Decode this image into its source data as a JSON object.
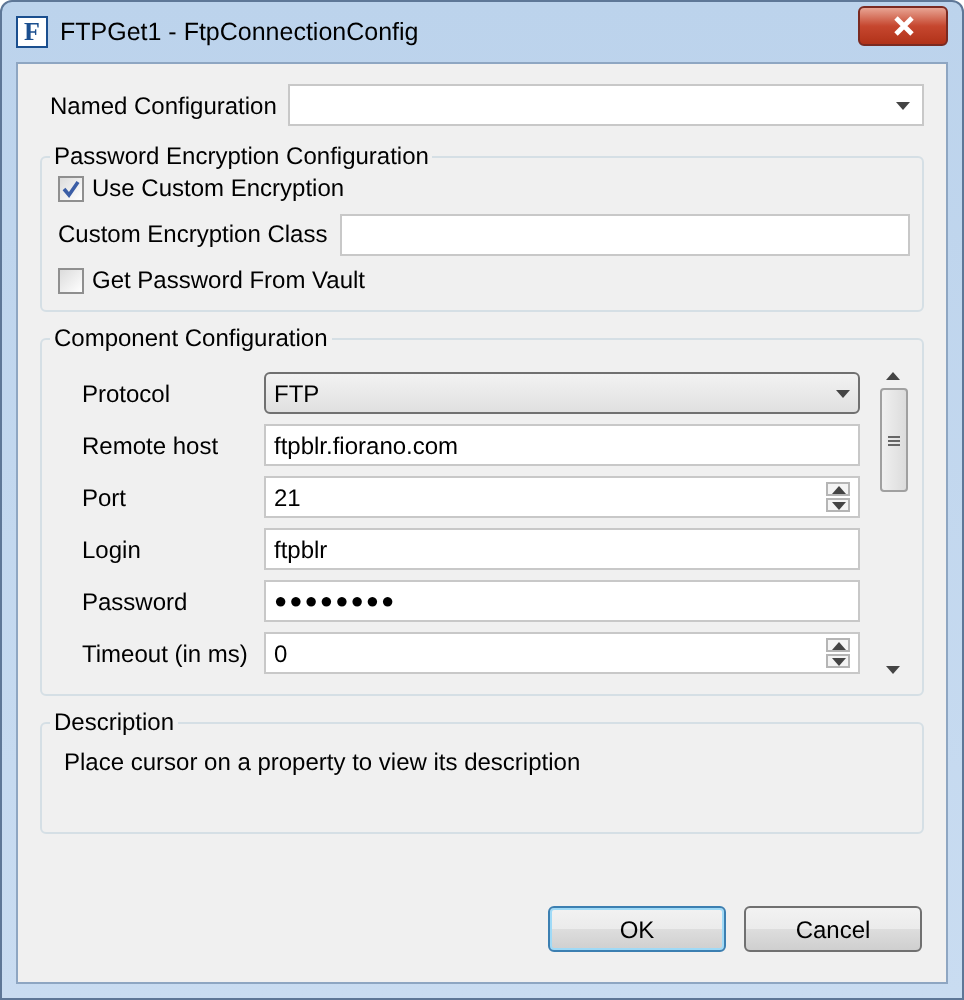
{
  "window": {
    "app_icon": "F",
    "title": "FTPGet1 - FtpConnectionConfig"
  },
  "named_configuration": {
    "label": "Named Configuration"
  },
  "password_encryption": {
    "title": "Password Encryption Configuration",
    "use_custom_encryption": {
      "label": "Use Custom Encryption",
      "checked": true
    },
    "custom_encryption_class": {
      "label": "Custom Encryption Class"
    },
    "get_password_from_vault": {
      "label": "Get Password From Vault",
      "checked": false
    }
  },
  "component_configuration": {
    "title": "Component Configuration",
    "properties": [
      {
        "kind": "dropdown",
        "label": "Protocol",
        "value": "FTP"
      },
      {
        "kind": "text",
        "label": "Remote host",
        "value": "ftpblr.fiorano.com"
      },
      {
        "kind": "spinner",
        "label": "Port",
        "value": "21"
      },
      {
        "kind": "text",
        "label": "Login",
        "value": "ftpblr"
      },
      {
        "kind": "password",
        "label": "Password",
        "value": "●●●●●●●●"
      },
      {
        "kind": "spinner",
        "label": "Timeout (in ms)",
        "value": "0"
      }
    ]
  },
  "description": {
    "title": "Description",
    "text": "Place cursor on a property to view its description"
  },
  "buttons": [
    {
      "label": "OK",
      "default": true
    },
    {
      "label": "Cancel",
      "default": false
    }
  ]
}
